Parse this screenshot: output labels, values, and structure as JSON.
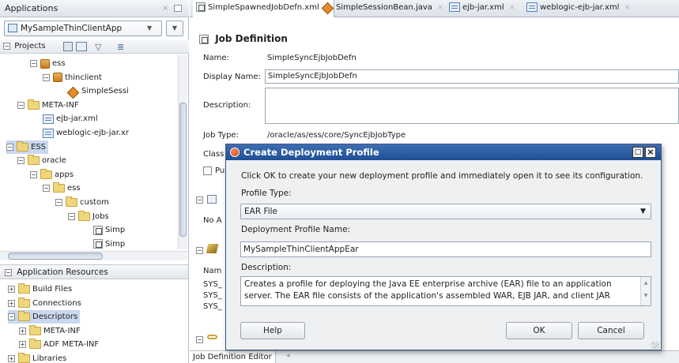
{
  "left_panel": {
    "applications_title": "Applications",
    "app_selector": "MySampleThinClientApp",
    "projects_label": "Projects",
    "tree": [
      {
        "label": "ess",
        "icon": "package-icon",
        "indent": 1
      },
      {
        "label": "thinclient",
        "icon": "package-icon",
        "indent": 2
      },
      {
        "label": "SimpleSessi",
        "icon": "bean-icon",
        "indent": 3
      },
      {
        "label": "META-INF",
        "icon": "folder-icon",
        "indent": 0
      },
      {
        "label": "ejb-jar.xml",
        "icon": "xml-file-icon",
        "indent": 1
      },
      {
        "label": "weblogic-ejb-jar.xr",
        "icon": "xml-file-icon",
        "indent": 1
      },
      {
        "label": "ESS",
        "icon": "folder-icon",
        "indent": -1,
        "selected": true
      },
      {
        "label": "oracle",
        "icon": "folder-icon",
        "indent": 0
      },
      {
        "label": "apps",
        "icon": "folder-icon",
        "indent": 1
      },
      {
        "label": "ess",
        "icon": "folder-icon",
        "indent": 2
      },
      {
        "label": "custom",
        "icon": "folder-icon",
        "indent": 3
      },
      {
        "label": "Jobs",
        "icon": "folder-icon",
        "indent": 4
      },
      {
        "label": "Simp",
        "icon": "job-file-icon",
        "indent": 5
      },
      {
        "label": "Simp",
        "icon": "job-file-icon",
        "indent": 5
      }
    ],
    "app_resources_label": "Application Resources",
    "resources": [
      {
        "label": "Build Files",
        "indent": 0
      },
      {
        "label": "Connections",
        "indent": 0
      },
      {
        "label": "Descriptors",
        "indent": 0,
        "selected": true
      },
      {
        "label": "META-INF",
        "indent": 1
      },
      {
        "label": "ADF META-INF",
        "indent": 1
      },
      {
        "label": "Libraries",
        "indent": 0
      }
    ]
  },
  "tabs": [
    {
      "label": "SimpleSpawnedJobDefn.xml",
      "icon": "job-file-icon"
    },
    {
      "label": "SimpleSessionBean.java",
      "icon": "bean-icon"
    },
    {
      "label": "ejb-jar.xml",
      "icon": "xml-file-icon"
    },
    {
      "label": "weblogic-ejb-jar.xml",
      "icon": "xml-file-icon"
    }
  ],
  "editor": {
    "section_title": "Job Definition",
    "name_label": "Name:",
    "name_value": "SimpleSyncEjbJobDefn",
    "display_name_label": "Display Name:",
    "display_name_value": "SimpleSyncEjbJobDefn",
    "description_label": "Description:",
    "job_type_label": "Job Type:",
    "job_type_value": "/oracle/as/ess/core/SyncEjbJobType",
    "class_label": "Class",
    "pu_label": "Pu",
    "no_a_label": "No A",
    "nam_label": "Nam",
    "sys_rows": [
      "SYS_",
      "SYS_",
      "SYS_"
    ],
    "bottom_tab": "Job Definition Editor"
  },
  "dialog": {
    "title": "Create Deployment Profile",
    "intro": "Click OK to create your new deployment profile and immediately open it to see its configuration.",
    "profile_type_label": "Profile Type:",
    "profile_type_value": "EAR File",
    "profile_name_label": "Deployment Profile Name:",
    "profile_name_value": "MySampleThinClientAppEar",
    "description_label": "Description:",
    "description_text": "Creates a profile for deploying the Java EE enterprise archive (EAR) file to an application server.  The EAR file consists of the application's assembled WAR, EJB JAR, and client JAR",
    "help_button": "Help",
    "ok_button": "OK",
    "cancel_button": "Cancel"
  },
  "colors": {
    "dialog_title_bg": "#2a5aa0",
    "selection_bg": "#c9d8ee",
    "panel_header_bg": "#e4e7ec"
  }
}
